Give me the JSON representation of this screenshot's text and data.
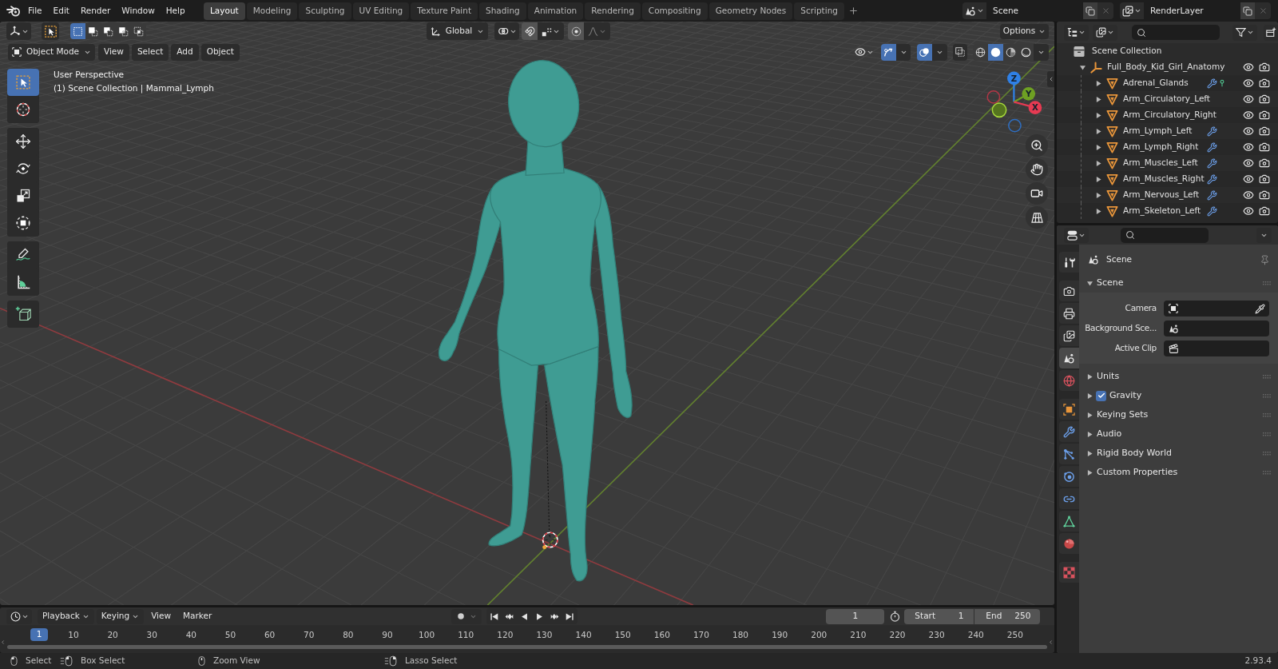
{
  "top_bar": {
    "menus": [
      "File",
      "Edit",
      "Render",
      "Window",
      "Help"
    ],
    "workspaces": [
      {
        "label": "Layout",
        "selected": true
      },
      {
        "label": "Modeling",
        "selected": false
      },
      {
        "label": "Sculpting",
        "selected": false
      },
      {
        "label": "UV Editing",
        "selected": false
      },
      {
        "label": "Texture Paint",
        "selected": false
      },
      {
        "label": "Shading",
        "selected": false
      },
      {
        "label": "Animation",
        "selected": false
      },
      {
        "label": "Rendering",
        "selected": false
      },
      {
        "label": "Compositing",
        "selected": false
      },
      {
        "label": "Geometry Nodes",
        "selected": false
      },
      {
        "label": "Scripting",
        "selected": false
      }
    ],
    "scene": "Scene",
    "view_layer": "RenderLayer"
  },
  "viewport": {
    "header": {
      "select_modes": [
        {
          "kind": "set",
          "selected": true
        },
        {
          "kind": "extend",
          "selected": false
        },
        {
          "kind": "subtract",
          "selected": false
        },
        {
          "kind": "difference",
          "selected": false
        },
        {
          "kind": "intersect",
          "selected": false
        }
      ],
      "orientation": "Global",
      "options": "Options",
      "mode": "Object Mode",
      "menus": [
        "View",
        "Select",
        "Add",
        "Object"
      ],
      "show_gizmos": true,
      "show_overlays": true,
      "xray": false,
      "shading": [
        {
          "kind": "wireframe",
          "selected": false
        },
        {
          "kind": "solid",
          "selected": true
        },
        {
          "kind": "material",
          "selected": false
        },
        {
          "kind": "rendered",
          "selected": false
        }
      ]
    },
    "tool_groups": [
      [
        {
          "kind": "select_box",
          "selected": true
        },
        {
          "kind": "cursor",
          "selected": false
        }
      ],
      [
        {
          "kind": "move",
          "selected": false
        },
        {
          "kind": "rotate",
          "selected": false
        },
        {
          "kind": "scale",
          "selected": false
        },
        {
          "kind": "transform",
          "selected": false
        }
      ],
      [
        {
          "kind": "annotate",
          "selected": false
        },
        {
          "kind": "measure",
          "selected": false
        }
      ],
      [
        {
          "kind": "add_cube",
          "selected": false
        }
      ]
    ],
    "info": [
      "User Perspective",
      "(1) Scene Collection | Mammal_Lymph"
    ],
    "axes": [
      {
        "kind": "z",
        "label": "Z"
      },
      {
        "kind": "y",
        "label": "Y"
      },
      {
        "kind": "x",
        "label": "X"
      }
    ]
  },
  "outliner": {
    "root": "Scene Collection",
    "items": [
      {
        "name": "Full_Body_Kid_Girl_Anatomy",
        "kind": "empty",
        "expanded": true,
        "visible": true,
        "renderable": true,
        "children": [
          {
            "name": "Adrenal_Glands",
            "kind": "mesh",
            "expanded": false,
            "modifier": true,
            "vertex_groups": true,
            "visible": true,
            "renderable": true
          },
          {
            "name": "Arm_Circulatory_Left",
            "kind": "mesh",
            "expanded": false,
            "modifier": false,
            "vertex_groups": false,
            "visible": true,
            "renderable": true
          },
          {
            "name": "Arm_Circulatory_Right",
            "kind": "mesh",
            "expanded": false,
            "modifier": false,
            "vertex_groups": false,
            "visible": true,
            "renderable": true
          },
          {
            "name": "Arm_Lymph_Left",
            "kind": "mesh",
            "expanded": false,
            "modifier": true,
            "vertex_groups": false,
            "visible": true,
            "renderable": true
          },
          {
            "name": "Arm_Lymph_Right",
            "kind": "mesh",
            "expanded": false,
            "modifier": true,
            "vertex_groups": false,
            "visible": true,
            "renderable": true
          },
          {
            "name": "Arm_Muscles_Left",
            "kind": "mesh",
            "expanded": false,
            "modifier": true,
            "vertex_groups": false,
            "visible": true,
            "renderable": true
          },
          {
            "name": "Arm_Muscles_Right",
            "kind": "mesh",
            "expanded": false,
            "modifier": true,
            "vertex_groups": false,
            "visible": true,
            "renderable": true
          },
          {
            "name": "Arm_Nervous_Left",
            "kind": "mesh",
            "expanded": false,
            "modifier": true,
            "vertex_groups": false,
            "visible": true,
            "renderable": true
          },
          {
            "name": "Arm_Skeleton_Left",
            "kind": "mesh",
            "expanded": false,
            "modifier": true,
            "vertex_groups": false,
            "visible": true,
            "renderable": true
          }
        ]
      }
    ]
  },
  "properties": {
    "tabs": [
      {
        "kind": "tool",
        "selected": false
      },
      {
        "kind": "render",
        "selected": false
      },
      {
        "kind": "output",
        "selected": false
      },
      {
        "kind": "view_layer",
        "selected": false
      },
      {
        "kind": "scene",
        "selected": true
      },
      {
        "kind": "world",
        "selected": false
      },
      {
        "kind": "object",
        "selected": false
      },
      {
        "kind": "modifiers",
        "selected": false
      },
      {
        "kind": "particles",
        "selected": false
      },
      {
        "kind": "physics",
        "selected": false
      },
      {
        "kind": "constraints",
        "selected": false
      },
      {
        "kind": "data",
        "selected": false
      },
      {
        "kind": "material",
        "selected": false
      },
      {
        "kind": "texture",
        "selected": false
      }
    ],
    "context": "Scene",
    "panels": [
      {
        "title": "Scene",
        "expanded": true,
        "fields": [
          {
            "label": "Camera",
            "kind": "camera"
          },
          {
            "label": "Background Sce...",
            "kind": "scene"
          },
          {
            "label": "Active Clip",
            "kind": "clip"
          }
        ]
      },
      {
        "title": "Units",
        "expanded": false
      },
      {
        "title": "Gravity",
        "expanded": false,
        "checked": true
      },
      {
        "title": "Keying Sets",
        "expanded": false
      },
      {
        "title": "Audio",
        "expanded": false
      },
      {
        "title": "Rigid Body World",
        "expanded": false
      },
      {
        "title": "Custom Properties",
        "expanded": false
      }
    ]
  },
  "timeline": {
    "menus": [
      {
        "label": "Playback",
        "dropdown": true
      },
      {
        "label": "Keying",
        "dropdown": true
      },
      {
        "label": "View",
        "dropdown": false
      },
      {
        "label": "Marker",
        "dropdown": false
      }
    ],
    "current_frame": "1",
    "start": {
      "label": "Start",
      "value": "1"
    },
    "end": {
      "label": "End",
      "value": "250"
    },
    "playhead": "1",
    "ruler": [
      "10",
      "20",
      "30",
      "40",
      "50",
      "60",
      "70",
      "80",
      "90",
      "100",
      "110",
      "120",
      "130",
      "140",
      "150",
      "160",
      "170",
      "180",
      "190",
      "200",
      "210",
      "220",
      "230",
      "240",
      "250"
    ]
  },
  "status_bar": {
    "hints": [
      {
        "kind": "click",
        "label": "Select"
      },
      {
        "kind": "drag",
        "label": "Box Select"
      },
      {
        "kind": "middle",
        "label": "Zoom View"
      },
      {
        "kind": "right_drag",
        "label": "Lasso Select"
      }
    ],
    "version": "2.93.4"
  }
}
